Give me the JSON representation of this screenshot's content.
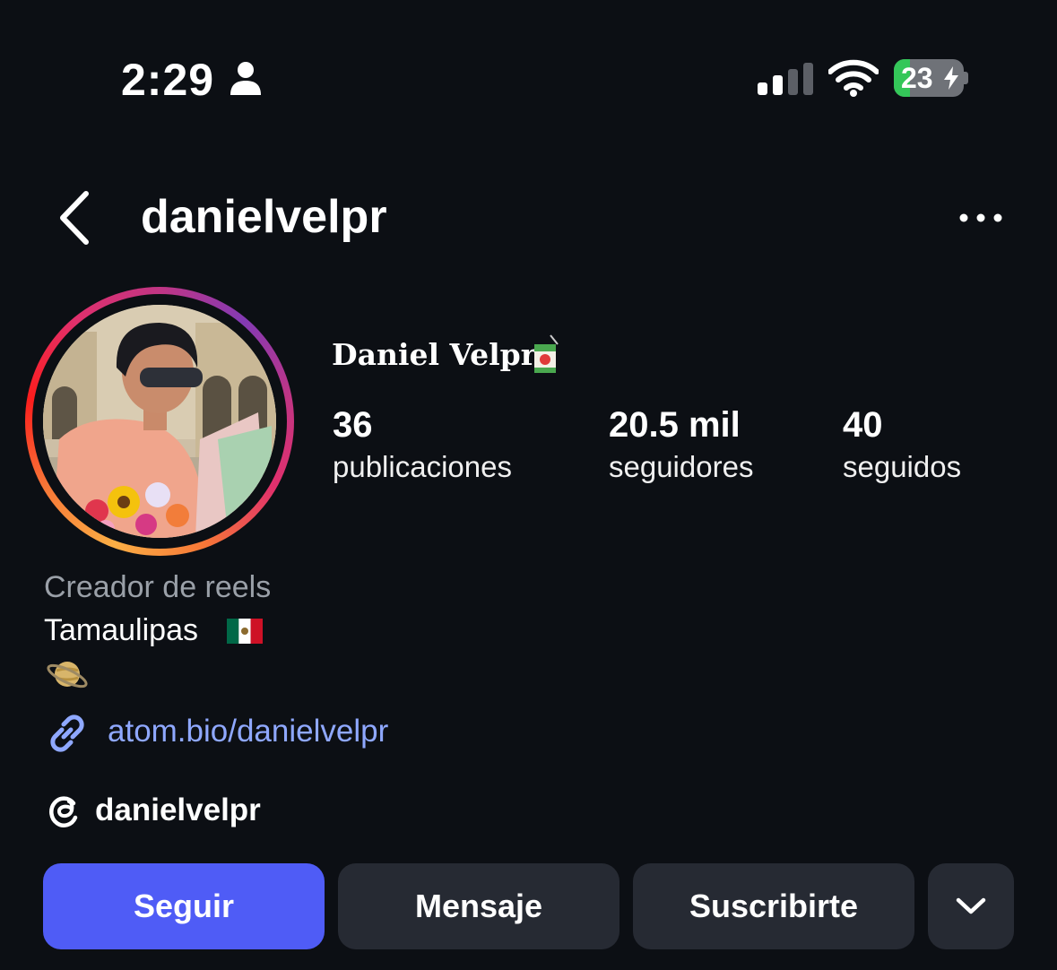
{
  "status_bar": {
    "time": "2:29",
    "battery_level": "23",
    "icons": [
      "person-icon",
      "cellular-signal-icon",
      "wifi-icon",
      "battery-charging-icon"
    ]
  },
  "header": {
    "username": "danielvelpr",
    "icons": [
      "chevron-left-icon",
      "more-horizontal-icon"
    ]
  },
  "profile": {
    "display_name": "Daniel Velpr",
    "name_emoji": "juice-box-icon",
    "stats": [
      {
        "value": "36",
        "label": "publicaciones"
      },
      {
        "value": "20.5 mil",
        "label": "seguidores"
      },
      {
        "value": "40",
        "label": "seguidos"
      }
    ]
  },
  "bio": {
    "category": "Creador de reels",
    "location": "Tamaulipas",
    "location_emoji": "mexico-flag-icon",
    "extra_emoji": "ringed-planet-icon",
    "link": "atom.bio/danielvelpr",
    "threads_handle": "danielvelpr"
  },
  "actions": {
    "follow": "Seguir",
    "message": "Mensaje",
    "subscribe": "Suscribirte",
    "more_icon": "chevron-down-icon"
  },
  "colors": {
    "background": "#0c0f14",
    "follow_button": "#4f5cf6",
    "secondary_button": "#262a33",
    "link": "#8fa8ff",
    "battery_green": "#34c759"
  }
}
